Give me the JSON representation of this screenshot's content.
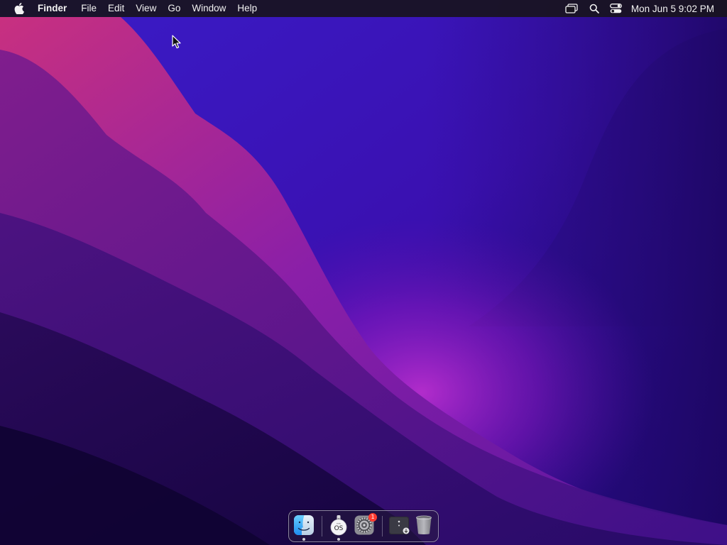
{
  "menubar": {
    "apple_icon": "apple-logo-icon",
    "app_name": "Finder",
    "menus": [
      "File",
      "Edit",
      "View",
      "Go",
      "Window",
      "Help"
    ],
    "status_icons": [
      "screen-mirroring-icon",
      "spotlight-search-icon",
      "control-center-icon"
    ],
    "clock": "Mon Jun 5  9:02 PM"
  },
  "wallpaper": {
    "name": "purple-mountain-wave-wallpaper",
    "colors": {
      "deep": "#1a0650",
      "mid": "#3a0fa8",
      "accent_pink": "#c0287a",
      "glow_magenta": "#a020c8"
    }
  },
  "cursor": {
    "icon": "arrow-pointer-icon"
  },
  "dock": {
    "items": [
      {
        "name": "Finder",
        "icon": "finder-icon",
        "running": true
      },
      {
        "name": "macOS Installer",
        "icon": "macos-installer-icon",
        "label": "OS",
        "running": true
      },
      {
        "name": "System Preferences",
        "icon": "system-preferences-icon",
        "badge": "1",
        "running": false
      },
      {
        "name": "Downloads",
        "icon": "downloads-stack-icon",
        "running": false
      },
      {
        "name": "Trash",
        "icon": "trash-icon",
        "running": false
      }
    ]
  }
}
